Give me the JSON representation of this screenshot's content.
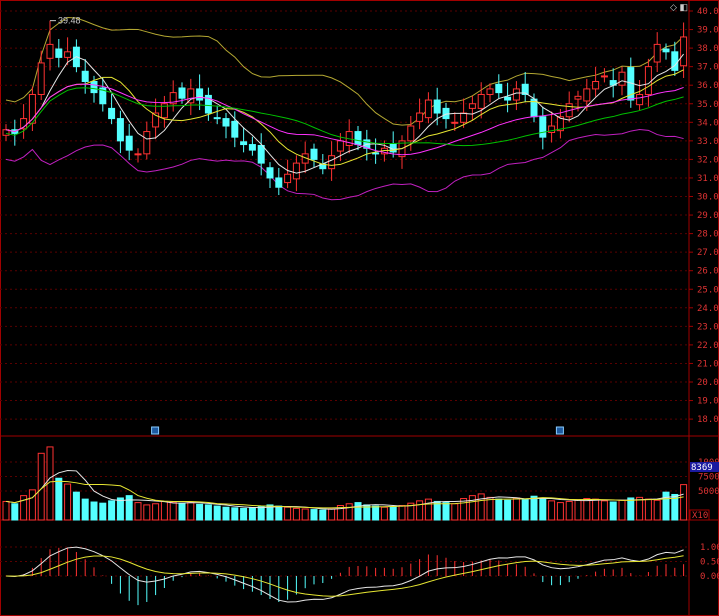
{
  "chart_data": {
    "type": "candlestick",
    "title": "",
    "price_axis": {
      "ticks": [
        "40.00",
        "39.00",
        "38.00",
        "37.00",
        "36.00",
        "35.00",
        "34.00",
        "33.00",
        "32.00",
        "31.00",
        "30.00",
        "29.00",
        "28.00",
        "27.00",
        "26.00",
        "25.00",
        "24.00",
        "23.00",
        "22.00",
        "21.00",
        "20.00",
        "19.00",
        "18.00"
      ],
      "ylim": [
        18,
        40
      ]
    },
    "high_annotation": "39.48",
    "close": [
      33.6,
      33.4,
      34.2,
      35.5,
      37.2,
      38.2,
      37.5,
      37.8,
      37.0,
      36.2,
      35.6,
      35.0,
      34.2,
      33.0,
      32.5,
      32.3,
      33.5,
      34.5,
      35.0,
      35.6,
      35.3,
      35.8,
      35.2,
      34.5,
      34.2,
      33.8,
      33.2,
      32.8,
      32.5,
      31.8,
      31.0,
      30.5,
      31.2,
      31.8,
      32.3,
      32.0,
      31.5,
      32.2,
      33.0,
      33.5,
      32.8,
      32.6,
      32.3,
      32.6,
      32.4,
      33.0,
      33.8,
      34.5,
      35.2,
      34.5,
      34.2,
      34.0,
      34.5,
      35.0,
      35.5,
      35.8,
      35.6,
      35.2,
      35.8,
      35.5,
      34.3,
      33.2,
      33.8,
      34.3,
      35.0,
      35.4,
      35.8,
      36.2,
      36.5,
      36.0,
      36.7,
      35.2,
      35.5,
      37.0,
      38.2,
      37.8,
      36.8,
      38.6
    ],
    "volume": [
      3200,
      2800,
      4200,
      5200,
      11500,
      12600,
      7200,
      6200,
      4800,
      3600,
      3100,
      2900,
      3300,
      3800,
      4200,
      3000,
      2600,
      2800,
      3200,
      3100,
      2900,
      3000,
      2700,
      2600,
      2400,
      2200,
      2100,
      2000,
      2100,
      2300,
      2600,
      2400,
      2200,
      2000,
      1900,
      1800,
      1700,
      1900,
      2500,
      2800,
      3000,
      2600,
      2400,
      2200,
      2300,
      2500,
      2900,
      3300,
      3600,
      3200,
      3000,
      2800,
      3700,
      4200,
      4500,
      3900,
      3600,
      3400,
      3800,
      3500,
      4100,
      3800,
      3300,
      3000,
      3200,
      3500,
      3700,
      3600,
      3300,
      3100,
      3400,
      3800,
      3900,
      3600,
      3400,
      4800,
      4400,
      6100
    ],
    "volume_axis": {
      "ticks": [
        "10000",
        "7500",
        "5000"
      ],
      "current": "8369",
      "unit": "X10"
    },
    "macd_axis": {
      "ticks": [
        "1.00",
        "0.50",
        "0.00"
      ]
    },
    "markers": [
      {
        "candle": 17
      },
      {
        "candle": 63
      }
    ]
  },
  "colors": {
    "up": "#ff3232",
    "down": "#54ffff",
    "ma5": "#e6e6e6",
    "ma10": "#e6e632",
    "ma20": "#ff32ff",
    "ma60": "#00c000",
    "boll_upper": "#b4a832",
    "boll_lower": "#c020c0",
    "grid": "#5a0000",
    "border": "#a00000"
  }
}
